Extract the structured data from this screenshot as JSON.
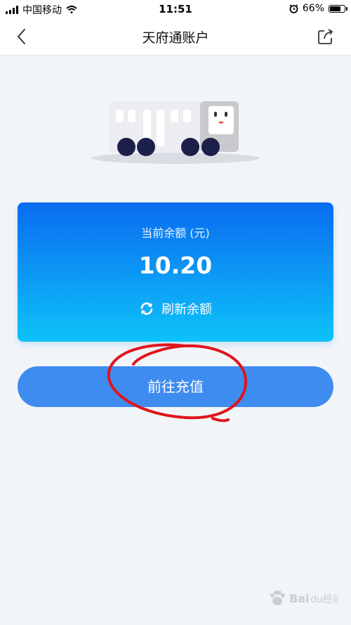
{
  "status_bar": {
    "carrier": "中国移动",
    "time": "11:51",
    "battery": "66%",
    "battery_level": 0.66,
    "icons": [
      "signal-icon",
      "wifi-icon",
      "alarm-icon",
      "battery-icon"
    ]
  },
  "nav": {
    "title": "天府通账户",
    "icons": [
      "back-chevron-icon",
      "share-icon"
    ]
  },
  "balance": {
    "label": "当前余额 (元)",
    "value": "10.20",
    "refresh_label": "刷新余额",
    "refresh_icon": "refresh-icon"
  },
  "actions": {
    "recharge_label": "前往充值"
  },
  "illustration": "bus-icon",
  "annotation": "red-hand-drawn-circle",
  "watermark": {
    "logo": "baidu-paw-icon",
    "text": "Baidu经验"
  },
  "colors": {
    "card_gradient_start": "#0a6cf0",
    "card_gradient_end": "#0ec2f9",
    "button": "#3f8cf0",
    "background": "#f2f5f8",
    "annotation_red": "#e0141b"
  }
}
